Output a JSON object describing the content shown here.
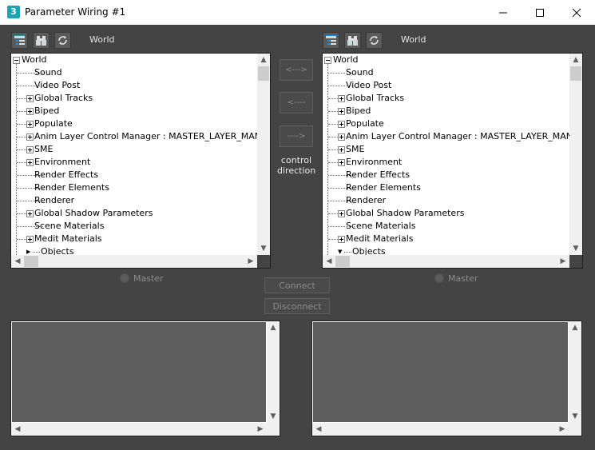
{
  "window": {
    "app_icon_text": "3",
    "title": "Parameter Wiring #1",
    "minimize_glyph": "—",
    "maximize_glyph": "☐",
    "close_glyph": "✕"
  },
  "left_panel": {
    "root_label": "World",
    "root": "World",
    "items": [
      {
        "label": "Sound",
        "expandable": false
      },
      {
        "label": "Video Post",
        "expandable": false
      },
      {
        "label": "Global Tracks",
        "expandable": true
      },
      {
        "label": "Biped",
        "expandable": true
      },
      {
        "label": "Populate",
        "expandable": true
      },
      {
        "label": "Anim Layer Control Manager : MASTER_LAYER_MANAGER",
        "expandable": true
      },
      {
        "label": "SME",
        "expandable": true
      },
      {
        "label": "Environment",
        "expandable": true
      },
      {
        "label": "Render Effects",
        "expandable": false
      },
      {
        "label": "Render Elements",
        "expandable": false
      },
      {
        "label": "Renderer",
        "expandable": false
      },
      {
        "label": "Global Shadow Parameters",
        "expandable": true
      },
      {
        "label": "Scene Materials",
        "expandable": false
      },
      {
        "label": "Medit Materials",
        "expandable": true
      },
      {
        "label": "Objects",
        "expandable": true,
        "arrow": "▶"
      }
    ],
    "master_label": "Master"
  },
  "right_panel": {
    "root_label": "World",
    "root": "World",
    "items": [
      {
        "label": "Sound",
        "expandable": false
      },
      {
        "label": "Video Post",
        "expandable": false
      },
      {
        "label": "Global Tracks",
        "expandable": true
      },
      {
        "label": "Biped",
        "expandable": true
      },
      {
        "label": "Populate",
        "expandable": true
      },
      {
        "label": "Anim Layer Control Manager : MASTER_LAYER_MANAGER",
        "expandable": true
      },
      {
        "label": "SME",
        "expandable": true
      },
      {
        "label": "Environment",
        "expandable": true
      },
      {
        "label": "Render Effects",
        "expandable": false
      },
      {
        "label": "Render Elements",
        "expandable": false
      },
      {
        "label": "Renderer",
        "expandable": false
      },
      {
        "label": "Global Shadow Parameters",
        "expandable": true
      },
      {
        "label": "Scene Materials",
        "expandable": false
      },
      {
        "label": "Medit Materials",
        "expandable": true
      },
      {
        "label": "Objects",
        "expandable": true,
        "arrow": "▼"
      }
    ],
    "master_label": "Master"
  },
  "direction": {
    "both_label": "<--->",
    "left_label": "<----",
    "right_label": "---->",
    "caption": "control\ndirection"
  },
  "actions": {
    "connect_label": "Connect",
    "disconnect_label": "Disconnect"
  },
  "scroll_glyphs": {
    "up": "▲",
    "down": "▼",
    "left": "◀",
    "right": "▶"
  },
  "colors": {
    "background": "#444444",
    "titlebar": "#ffffff",
    "app_icon": "#1aa2b7",
    "tree_bg": "#ffffff",
    "disabled_text": "#8a8a8a"
  }
}
